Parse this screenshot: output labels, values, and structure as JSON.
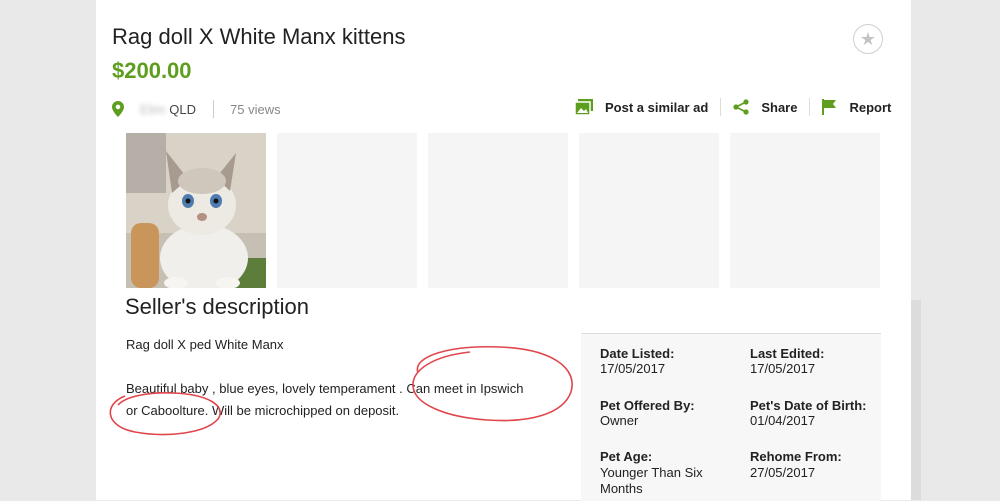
{
  "listing": {
    "title": "Rag doll X White Manx kittens",
    "price": "$200.00",
    "location_suburb": "Elim",
    "location_state": "QLD",
    "views": "75 views"
  },
  "actions": {
    "post_similar": "Post a similar ad",
    "share": "Share",
    "report": "Report"
  },
  "description": {
    "heading": "Seller's description",
    "line1": "Rag doll X ped White Manx",
    "line2": "Beautiful baby , blue eyes, lovely temperament . Can meet in Ipswich",
    "line3": "or Caboolture. Will be microchipped on deposit."
  },
  "details": {
    "date_listed_label": "Date Listed:",
    "date_listed_value": "17/05/2017",
    "last_edited_label": "Last Edited:",
    "last_edited_value": "17/05/2017",
    "offered_by_label": "Pet Offered By:",
    "offered_by_value": "Owner",
    "dob_label": "Pet's Date of Birth:",
    "dob_value": "01/04/2017",
    "age_label": "Pet Age:",
    "age_value": "Younger Than Six Months",
    "rehome_label": "Rehome From:",
    "rehome_value": "27/05/2017"
  },
  "colors": {
    "price_green": "#5d9e1e",
    "icon_green": "#5d9e1e",
    "annotation_red": "#e0464b"
  },
  "icons": [
    "star-icon",
    "location-pin-icon",
    "image-icon",
    "share-icon",
    "flag-icon"
  ]
}
